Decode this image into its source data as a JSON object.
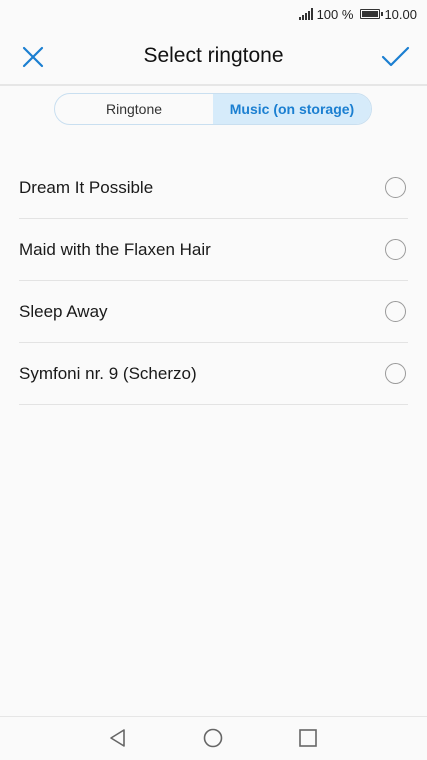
{
  "status_bar": {
    "battery_percent": "100 %",
    "time": "10.00",
    "icons": [
      "signal-icon",
      "battery-icon"
    ]
  },
  "header": {
    "title": "Select ringtone",
    "close_icon": "close-icon",
    "confirm_icon": "check-icon"
  },
  "tabs": [
    {
      "label": "Ringtone",
      "selected": false
    },
    {
      "label": "Music (on storage)",
      "selected": true
    }
  ],
  "songs": [
    {
      "label": "Dream It Possible",
      "selected": false
    },
    {
      "label": "Maid with the Flaxen Hair",
      "selected": false
    },
    {
      "label": "Sleep Away",
      "selected": false
    },
    {
      "label": "Symfoni nr. 9 (Scherzo)",
      "selected": false
    }
  ],
  "navbar": {
    "icons": [
      "back-icon",
      "home-icon",
      "recents-icon"
    ]
  },
  "colors": {
    "accent": "#1b7fd1",
    "segment_selected_bg": "#d6ebfa"
  }
}
